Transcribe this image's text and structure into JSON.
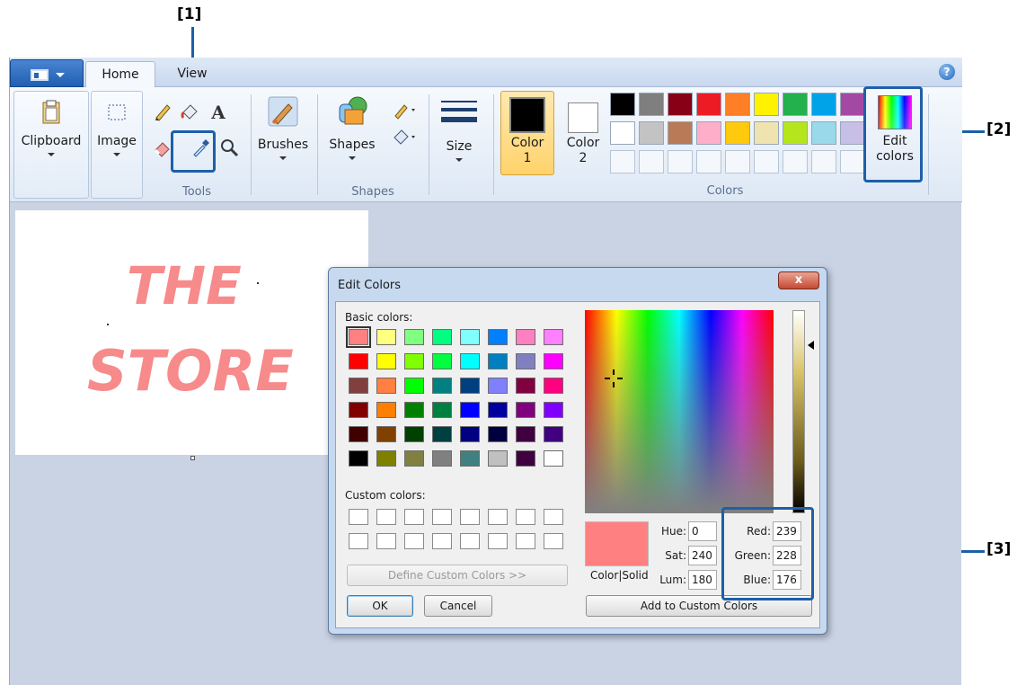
{
  "callouts": {
    "c1": "[1]",
    "c2": "[2]",
    "c3": "[3]"
  },
  "tabs": {
    "home": "Home",
    "view": "View"
  },
  "help": "?",
  "ribbon": {
    "clipboard": "Clipboard",
    "image": "Image",
    "tools_label": "Tools",
    "text_tool": "A",
    "brushes": "Brushes",
    "shapes": "Shapes",
    "shapes_label": "Shapes",
    "size": "Size",
    "color1_line1": "Color",
    "color1_line2": "1",
    "color2_line1": "Color",
    "color2_line2": "2",
    "colors_label": "Colors",
    "edit_line1": "Edit",
    "edit_line2": "colors",
    "palette_row1": [
      "#000000",
      "#7f7f7f",
      "#880015",
      "#ed1c24",
      "#ff7f27",
      "#fff200",
      "#22b14c",
      "#00a2e8",
      "#a349a4"
    ],
    "palette_row2": [
      "#ffffff",
      "#c3c3c3",
      "#b97a57",
      "#ffaec9",
      "#ffc90e",
      "#efe4b0",
      "#b5e61d",
      "#99d9ea",
      "#c8bfe7"
    ]
  },
  "canvas": {
    "line1": "THE",
    "line2": "STORE",
    "text_color": "#f78a8a"
  },
  "dialog": {
    "title": "Edit Colors",
    "close": "x",
    "basic_colors_label": "Basic colors:",
    "custom_colors_label": "Custom colors:",
    "define_button": "Define Custom Colors >>",
    "ok_button": "OK",
    "cancel_button": "Cancel",
    "color_solid_label": "Color|Solid",
    "add_button": "Add to Custom Colors",
    "hue_label": "Hue:",
    "hue": "0",
    "sat_label": "Sat:",
    "sat": "240",
    "lum_label": "Lum:",
    "lum": "180",
    "red_label": "Red:",
    "red": "239",
    "green_label": "Green:",
    "green": "228",
    "blue_label": "Blue:",
    "blue": "176",
    "selected_color": "#ff8080",
    "basic_colors": [
      [
        "#ff8080",
        "#ffff80",
        "#80ff80",
        "#00ff80",
        "#80ffff",
        "#0080ff",
        "#ff80c0",
        "#ff80ff"
      ],
      [
        "#ff0000",
        "#ffff00",
        "#80ff00",
        "#00ff40",
        "#00ffff",
        "#0080c0",
        "#8080c0",
        "#ff00ff"
      ],
      [
        "#804040",
        "#ff8040",
        "#00ff00",
        "#008080",
        "#004080",
        "#8080ff",
        "#800040",
        "#ff0080"
      ],
      [
        "#800000",
        "#ff8000",
        "#008000",
        "#008040",
        "#0000ff",
        "#0000a0",
        "#800080",
        "#8000ff"
      ],
      [
        "#400000",
        "#804000",
        "#004000",
        "#004040",
        "#000080",
        "#000040",
        "#400040",
        "#400080"
      ],
      [
        "#000000",
        "#808000",
        "#808040",
        "#808080",
        "#408080",
        "#c0c0c0",
        "#400040",
        "#ffffff"
      ]
    ]
  }
}
